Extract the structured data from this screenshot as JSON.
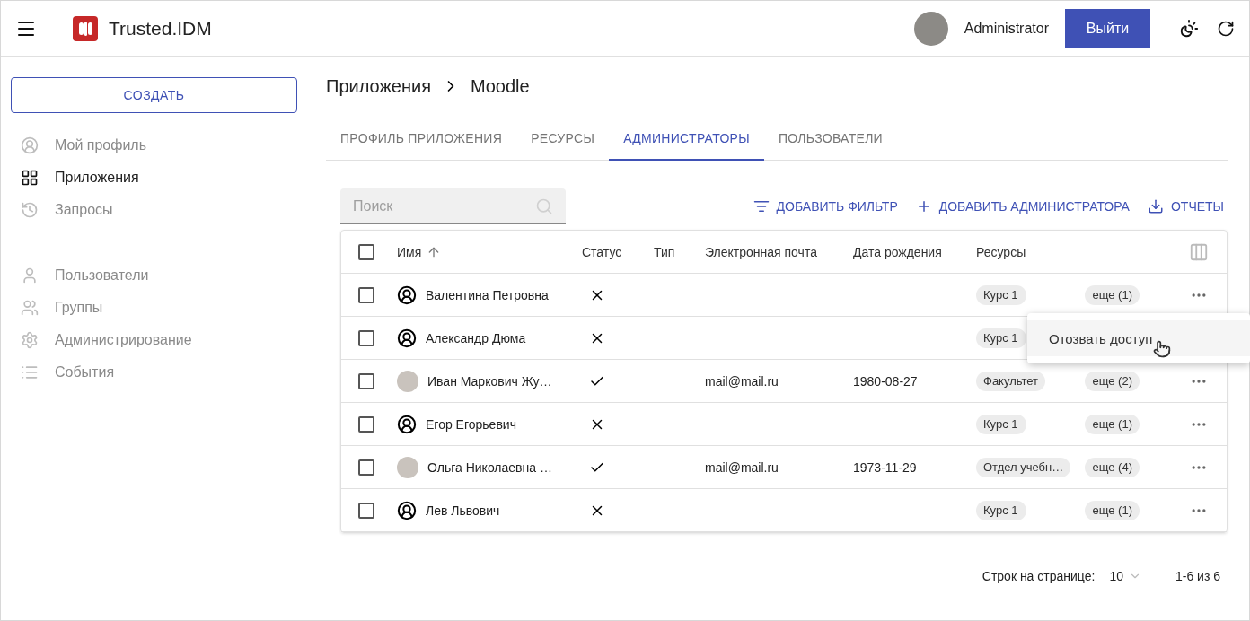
{
  "header": {
    "logo_text": "Trusted.IDM",
    "user_name": "Administrator",
    "logout_button": "Выйти"
  },
  "sidebar": {
    "create_button": "СОЗДАТЬ",
    "groups": [
      [
        {
          "label": "Мой профиль",
          "kind": "profile",
          "selected": false
        },
        {
          "label": "Приложения",
          "kind": "apps",
          "selected": true
        },
        {
          "label": "Запросы",
          "kind": "history",
          "selected": false
        }
      ],
      [
        {
          "label": "Пользователи",
          "kind": "user",
          "selected": false
        },
        {
          "label": "Группы",
          "kind": "users",
          "selected": false
        },
        {
          "label": "Администрирование",
          "kind": "settings",
          "selected": false
        },
        {
          "label": "События",
          "kind": "list",
          "selected": false
        }
      ]
    ]
  },
  "breadcrumb": [
    "Приложения",
    "Moodle"
  ],
  "tabs": [
    {
      "label": "ПРОФИЛЬ ПРИЛОЖЕНИЯ",
      "selected": false
    },
    {
      "label": "РЕСУРСЫ",
      "selected": false
    },
    {
      "label": "АДМИНИСТРАТОРЫ",
      "selected": true
    },
    {
      "label": "ПОЛЬЗОВАТЕЛИ",
      "selected": false
    }
  ],
  "search": {
    "placeholder": "Поиск"
  },
  "actions": [
    {
      "label": "ДОБАВИТЬ ФИЛЬТР",
      "kind": "filter"
    },
    {
      "label": "ДОБАВИТЬ АДМИНИСТРАТОРА",
      "kind": "add"
    },
    {
      "label": "ОТЧЕТЫ",
      "kind": "download"
    }
  ],
  "table": {
    "all_checked": false,
    "columns": [
      "Имя",
      "Статус",
      "Тип",
      "Электронная почта",
      "Дата рождения",
      "Ресурсы"
    ],
    "rows": [
      {
        "checked": false,
        "photo": false,
        "name": "Валентина Петровна",
        "active": false,
        "email": "",
        "birth_date": "",
        "resource": "Курс 1",
        "more": "еще (1)",
        "actions": true
      },
      {
        "checked": false,
        "photo": false,
        "name": "Александр Дюма",
        "active": false,
        "email": "",
        "birth_date": "",
        "resource": "Курс 1",
        "more": "",
        "actions": false
      },
      {
        "checked": false,
        "photo": true,
        "name": "Иван Маркович Жу…",
        "active": true,
        "email": "mail@mail.ru",
        "birth_date": "1980-08-27",
        "resource": "Факультет",
        "more": "еще (2)",
        "actions": true
      },
      {
        "checked": false,
        "photo": false,
        "name": "Егор Егорьевич",
        "active": false,
        "email": "",
        "birth_date": "",
        "resource": "Курс 1",
        "more": "еще (1)",
        "actions": true
      },
      {
        "checked": false,
        "photo": true,
        "name": "Ольга Николаевна …",
        "active": true,
        "email": "mail@mail.ru",
        "birth_date": "1973-11-29",
        "resource": "Отдел учебн…",
        "more": "еще (4)",
        "actions": true
      },
      {
        "checked": false,
        "photo": false,
        "name": "Лев Львович",
        "active": false,
        "email": "",
        "birth_date": "",
        "resource": "Курс 1",
        "more": "еще (1)",
        "actions": true
      }
    ]
  },
  "context_menu": {
    "items": [
      "Отозвать доступ"
    ]
  },
  "pagination": {
    "rows_per_page_label": "Строк на странице:",
    "rows_per_page": "10",
    "range": "1-6 из 6"
  }
}
